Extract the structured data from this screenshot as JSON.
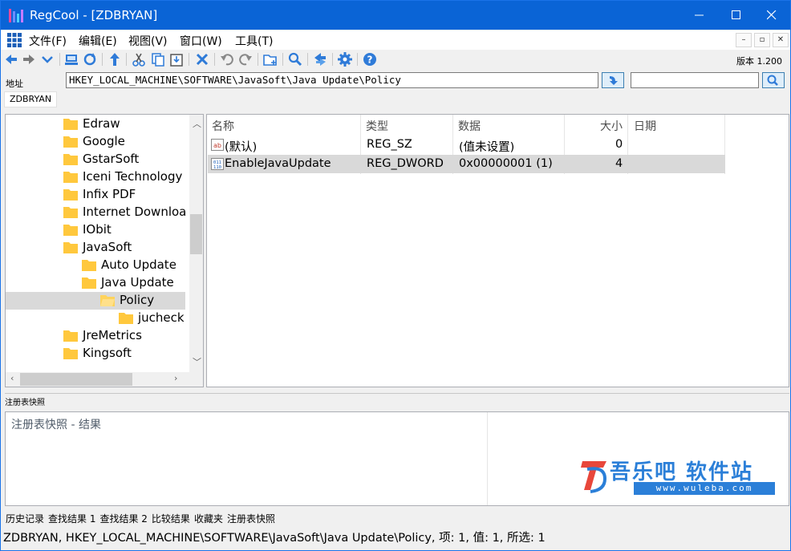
{
  "window": {
    "title": "RegCool - [ZDBRYAN]",
    "accent": "#0a64d6"
  },
  "menu": [
    "文件(F)",
    "编辑(E)",
    "视图(V)",
    "窗口(W)",
    "工具(T)"
  ],
  "toolbar": {
    "icons": [
      "back-icon",
      "forward-icon",
      "dropdown-icon",
      "computer-icon",
      "refresh-icon",
      "up-icon",
      "cut-icon",
      "copy-icon",
      "paste-icon",
      "delete-icon",
      "undo-icon",
      "redo-icon",
      "new-key-icon",
      "find-icon",
      "replace-icon",
      "settings-icon",
      "help-icon"
    ],
    "version": "版本 1.200"
  },
  "address": {
    "label": "地址",
    "value": "HKEY_LOCAL_MACHINE\\SOFTWARE\\JavaSoft\\Java Update\\Policy",
    "search_value": ""
  },
  "host_tab": "ZDBRYAN",
  "tree": {
    "items": [
      {
        "label": "Edraw",
        "level": 0
      },
      {
        "label": "Google",
        "level": 0
      },
      {
        "label": "GstarSoft",
        "level": 0
      },
      {
        "label": "Iceni Technology",
        "level": 0
      },
      {
        "label": "Infix PDF",
        "level": 0
      },
      {
        "label": "Internet Downloa",
        "level": 0
      },
      {
        "label": "IObit",
        "level": 0
      },
      {
        "label": "JavaSoft",
        "level": 0
      },
      {
        "label": "Auto Update",
        "level": 1
      },
      {
        "label": "Java Update",
        "level": 1
      },
      {
        "label": "Policy",
        "level": 2,
        "selected": true
      },
      {
        "label": "jucheck",
        "level": 3
      },
      {
        "label": "JreMetrics",
        "level": 0
      },
      {
        "label": "Kingsoft",
        "level": 0
      }
    ]
  },
  "list": {
    "columns": [
      "名称",
      "类型",
      "数据",
      "大小",
      "日期"
    ],
    "rows": [
      {
        "icon": "string-value-icon",
        "name": "(默认)",
        "type": "REG_SZ",
        "data": "(值未设置)",
        "size": "0",
        "date": ""
      },
      {
        "icon": "dword-value-icon",
        "name": "EnableJavaUpdate",
        "type": "REG_DWORD",
        "data": "0x00000001 (1)",
        "size": "4",
        "date": "",
        "selected": true
      }
    ]
  },
  "snapshot": {
    "label": "注册表快照",
    "title": "注册表快照 - 结果"
  },
  "watermark": {
    "title": "吾乐吧 软件站",
    "url": "www.wuleba.com"
  },
  "bottom_tabs": [
    "历史记录",
    "查找结果 1",
    "查找结果 2",
    "比较结果",
    "收藏夹",
    "注册表快照"
  ],
  "status": "ZDBRYAN, HKEY_LOCAL_MACHINE\\SOFTWARE\\JavaSoft\\Java Update\\Policy, 项: 1, 值: 1, 所选: 1"
}
